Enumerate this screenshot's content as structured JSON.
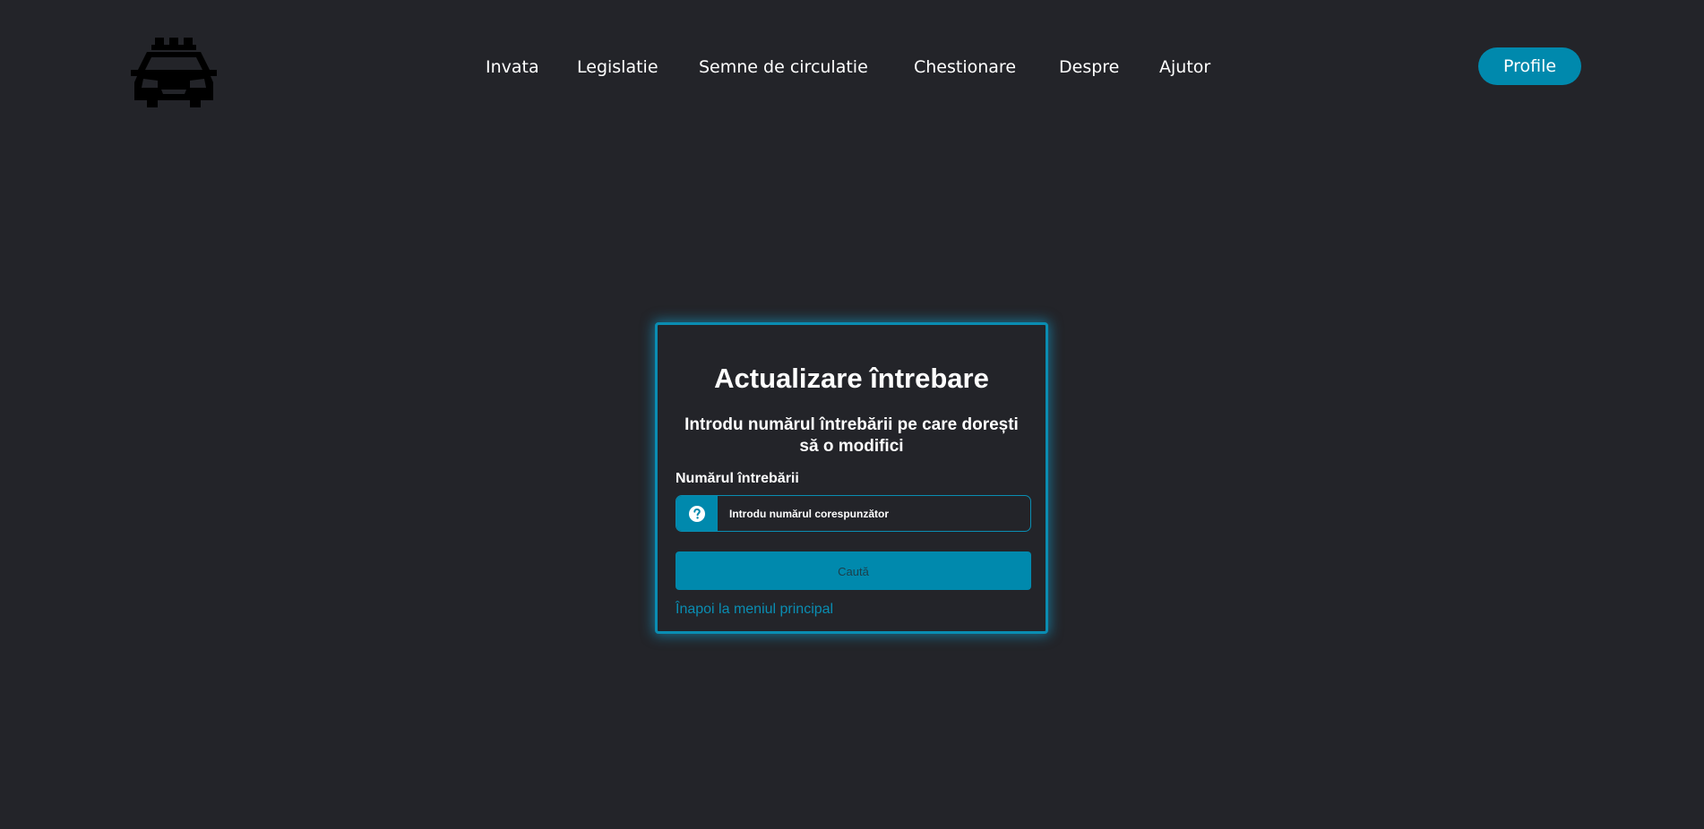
{
  "header": {
    "logo_icon": "taxi-car-icon",
    "nav": [
      {
        "label": "Invata"
      },
      {
        "label": "Legislatie"
      },
      {
        "label": "Semne de circulatie"
      },
      {
        "label": "Chestionare"
      },
      {
        "label": "Despre"
      },
      {
        "label": "Ajutor"
      }
    ],
    "profile_label": "Profile"
  },
  "card": {
    "title": "Actualizare întrebare",
    "subtitle": "Introdu numărul întrebării pe care dorești să o modifici",
    "field_label": "Numărul întrebării",
    "input_icon": "question-circle-icon",
    "input_value": "",
    "input_placeholder": "Introdu numărul corespunzător",
    "search_label": "Caută",
    "back_link": "Înapoi la meniul principal"
  },
  "colors": {
    "background": "#232429",
    "accent": "#0089ad",
    "border_accent": "#0a8db2",
    "text": "#ffffff"
  }
}
